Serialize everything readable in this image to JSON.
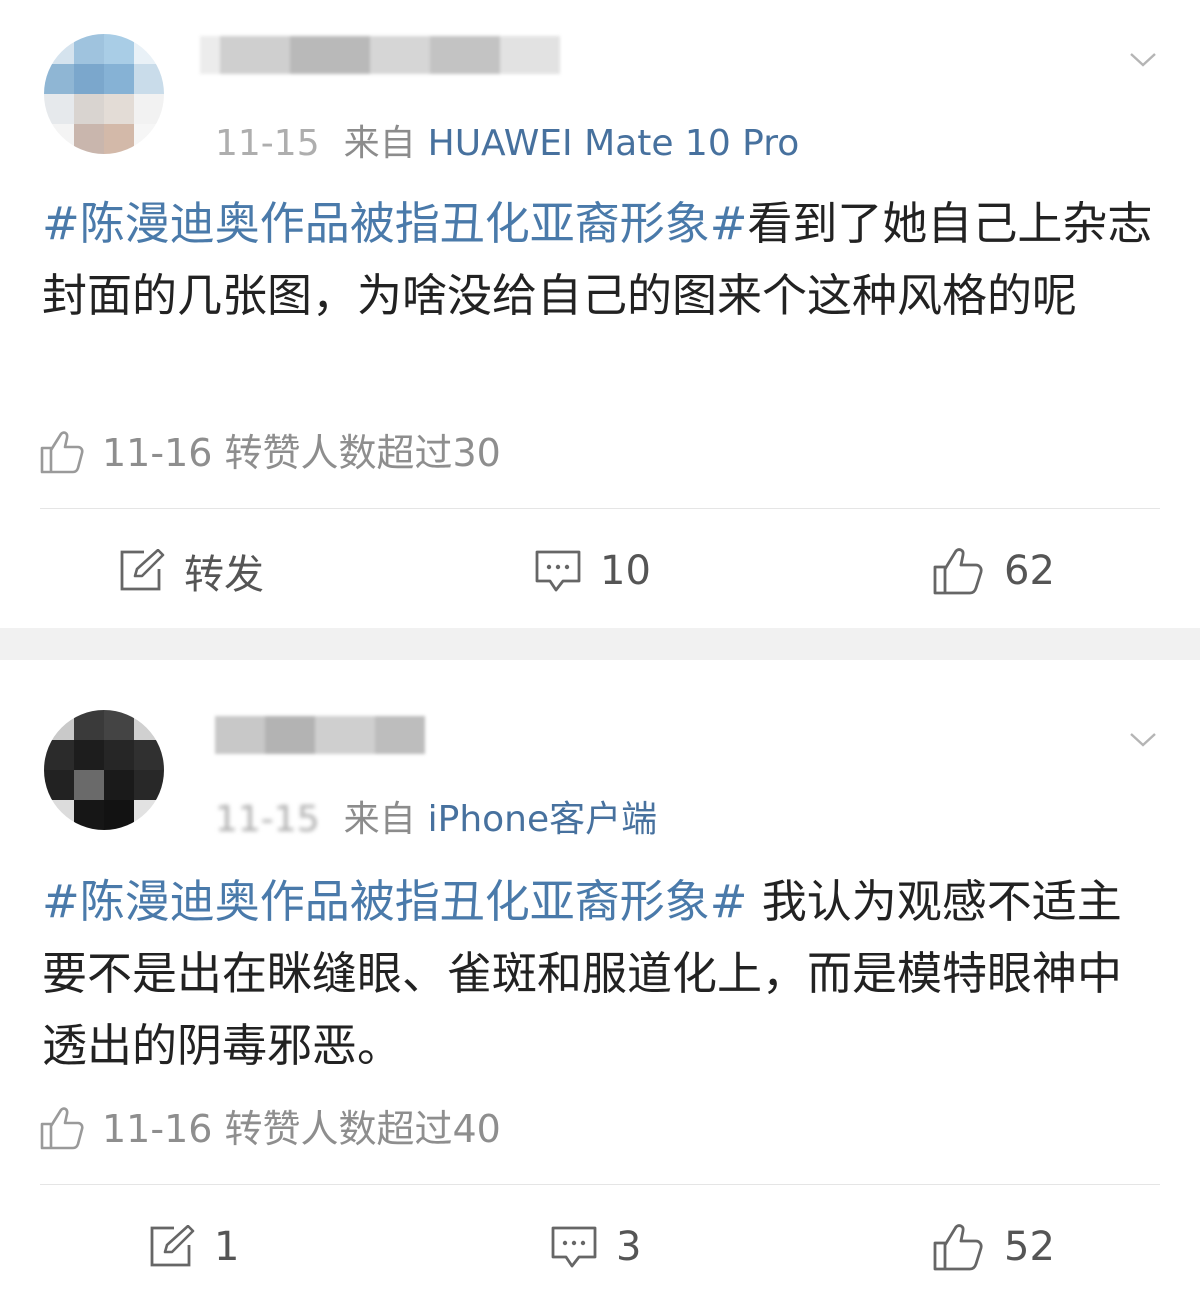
{
  "colors": {
    "hashtag": "#4a7aaa",
    "source": "#47719e",
    "meta": "#9a9a9a",
    "body_text": "#222222",
    "separator": "#f1f1f1"
  },
  "posts": [
    {
      "date": "11-15",
      "source_label": "来自",
      "source": "HUAWEI Mate 10 Pro",
      "hashtag": "#陈漫迪奥作品被指丑化亚裔形象#",
      "text": "看到了她自己上杂志封面的几张图，为啥没给自己的图来个这种风格的呢",
      "like_note": "11-16 转赞人数超过30",
      "actions": {
        "forward": "转发",
        "comments": "10",
        "likes": "62"
      },
      "icons": [
        "chevron-down-icon",
        "thumb-up-icon",
        "share-icon",
        "comment-icon",
        "like-icon"
      ]
    },
    {
      "date": "11-15",
      "source_label": "来自",
      "source": "iPhone客户端",
      "hashtag": "#陈漫迪奥作品被指丑化亚裔形象#",
      "text": " 我认为观感不适主要不是出在眯缝眼、雀斑和服道化上，而是模特眼神中透出的阴毒邪恶。",
      "like_note": "11-16 转赞人数超过40",
      "actions": {
        "forward": "1",
        "comments": "3",
        "likes": "52"
      },
      "icons": [
        "chevron-down-icon",
        "thumb-up-icon",
        "share-icon",
        "comment-icon",
        "like-icon"
      ]
    }
  ]
}
